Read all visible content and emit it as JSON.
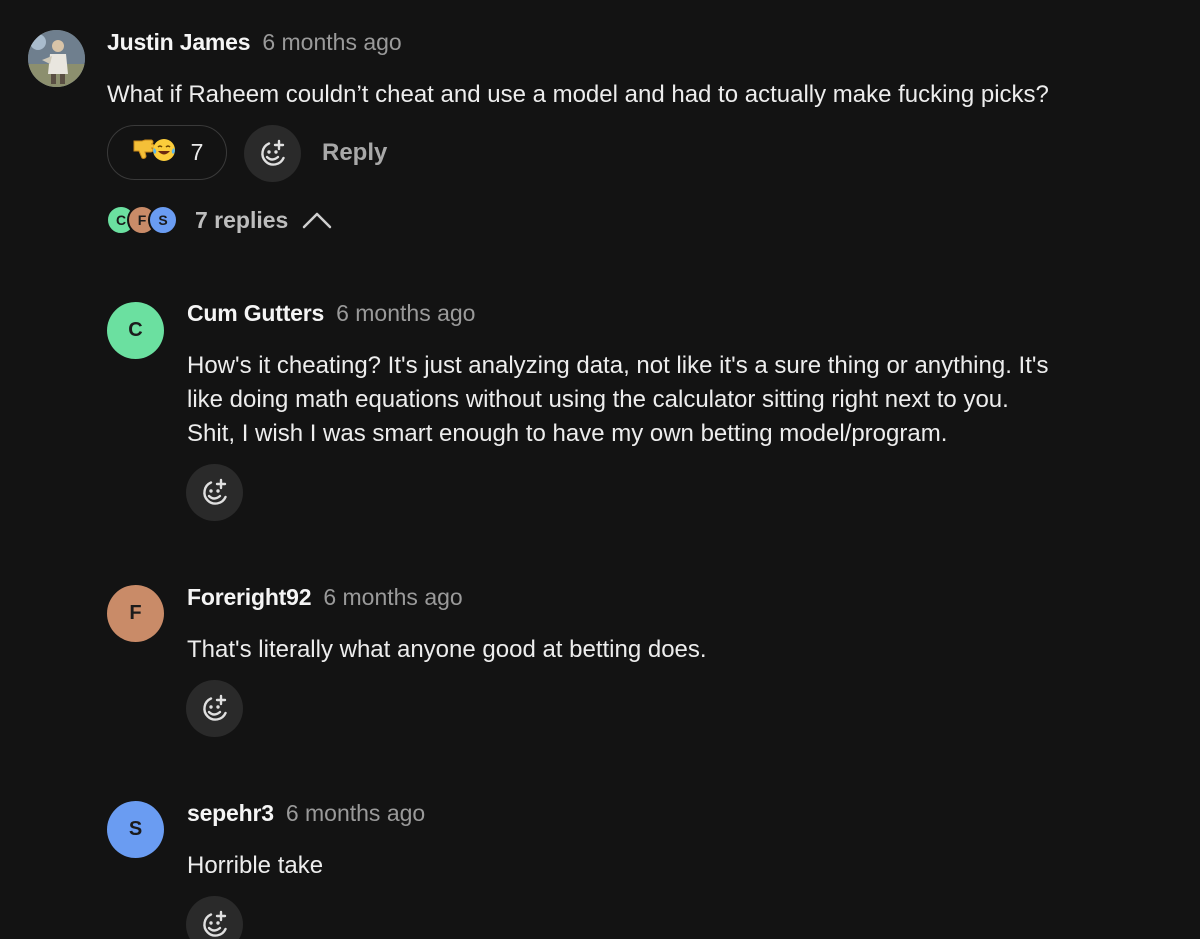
{
  "comment": {
    "author": "Justin James",
    "timestamp": "6 months ago",
    "text": "What if Raheem couldn’t cheat and use a model and had to actually make fucking picks?",
    "reaction_count": "7",
    "reply_label": "Reply",
    "replies_label": "7 replies",
    "reaction_icons": [
      "thumbs-down-icon",
      "laughing-tears-icon"
    ]
  },
  "reply_avatars": [
    {
      "letter": "C",
      "color": "#6be0a0"
    },
    {
      "letter": "F",
      "color": "#c98b68"
    },
    {
      "letter": "S",
      "color": "#6a9cf2"
    }
  ],
  "replies": [
    {
      "avatar_letter": "C",
      "avatar_color": "#6be0a0",
      "author": "Cum Gutters",
      "timestamp": "6 months ago",
      "text_lines": [
        "How's it cheating? It's just analyzing data, not like it's a sure thing or anything. It's",
        "like doing math equations without using the calculator sitting right next to you.",
        "Shit, I wish I was smart enough to have my own betting model/program."
      ]
    },
    {
      "avatar_letter": "F",
      "avatar_color": "#c98b68",
      "author": "Foreright92",
      "timestamp": "6 months ago",
      "text_lines": [
        "That's literally what anyone good at betting does."
      ]
    },
    {
      "avatar_letter": "S",
      "avatar_color": "#6a9cf2",
      "author": "sepehr3",
      "timestamp": "6 months ago",
      "text_lines": [
        "Horrible take"
      ]
    }
  ]
}
